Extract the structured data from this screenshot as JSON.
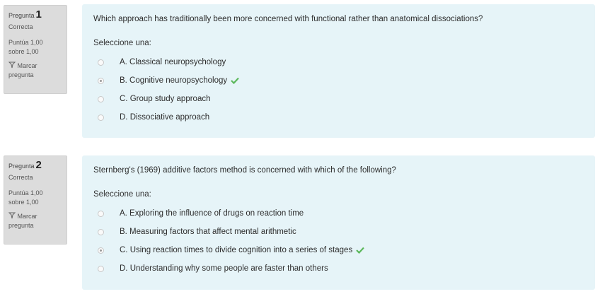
{
  "questions": [
    {
      "label": "Pregunta",
      "number": "1",
      "status": "Correcta",
      "score_line1": "Puntúa 1,00",
      "score_line2": "sobre 1,00",
      "flag_line1": "Marcar",
      "flag_line2": "pregunta",
      "text": "Which approach has traditionally been more concerned with functional rather than anatomical dissociations?",
      "prompt": "Seleccione una:",
      "options": [
        {
          "label": "A. Classical neuropsychology",
          "checked": false,
          "correct": false
        },
        {
          "label": "B. Cognitive neuropsychology",
          "checked": true,
          "correct": true
        },
        {
          "label": "C. Group study approach",
          "checked": false,
          "correct": false
        },
        {
          "label": "D. Dissociative approach",
          "checked": false,
          "correct": false
        }
      ]
    },
    {
      "label": "Pregunta",
      "number": "2",
      "status": "Correcta",
      "score_line1": "Puntúa 1,00",
      "score_line2": "sobre 1,00",
      "flag_line1": "Marcar",
      "flag_line2": "pregunta",
      "text": "Sternberg's (1969) additive factors method is concerned with which of the following?",
      "prompt": "Seleccione una:",
      "options": [
        {
          "label": "A. Exploring the influence of drugs on reaction time",
          "checked": false,
          "correct": false
        },
        {
          "label": "B. Measuring factors that affect mental arithmetic",
          "checked": false,
          "correct": false
        },
        {
          "label": "C. Using reaction times to divide cognition into a series of stages",
          "checked": true,
          "correct": true
        },
        {
          "label": "D. Understanding why some people are faster than others",
          "checked": false,
          "correct": false
        }
      ]
    }
  ],
  "colors": {
    "check": "#5cb85c",
    "content_bg": "#e6f4f8",
    "info_bg": "#dcdcdc"
  }
}
